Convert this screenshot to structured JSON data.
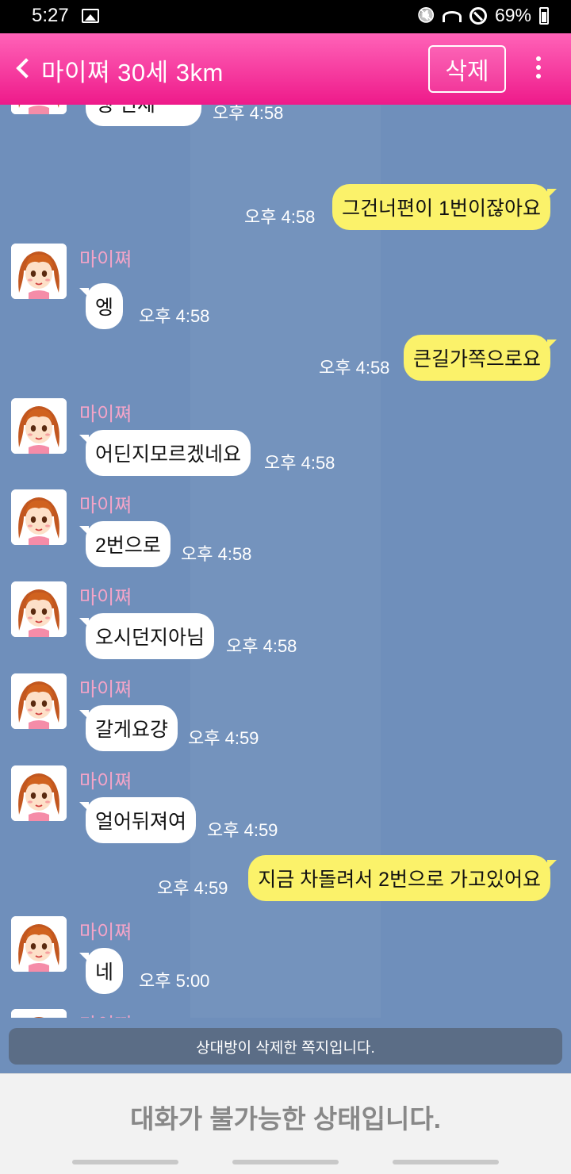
{
  "status_bar": {
    "time": "5:27",
    "battery": "69%"
  },
  "header": {
    "title": "마이쪄 30세 3km",
    "delete_label": "삭제"
  },
  "messages": [
    {
      "dir": "in",
      "sender": "마이쪄",
      "text": "엥 언제ㅡㅡ",
      "time": "오후 4:58"
    },
    {
      "dir": "out",
      "text": "그건너편이 1번이잖아요",
      "time": "오후 4:58"
    },
    {
      "dir": "in",
      "sender": "마이쪄",
      "text": "엥",
      "time": "오후 4:58"
    },
    {
      "dir": "out",
      "text": "큰길가쪽으로요",
      "time": "오후 4:58"
    },
    {
      "dir": "in",
      "sender": "마이쪄",
      "text": "어딘지모르겠네요",
      "time": "오후 4:58"
    },
    {
      "dir": "in",
      "sender": "마이쪄",
      "text": "2번으로",
      "time": "오후 4:58"
    },
    {
      "dir": "in",
      "sender": "마이쪄",
      "text": "오시던지아님",
      "time": "오후 4:58"
    },
    {
      "dir": "in",
      "sender": "마이쪄",
      "text": "갈게요걍",
      "time": "오후 4:59"
    },
    {
      "dir": "in",
      "sender": "마이쪄",
      "text": "얼어뒤져여",
      "time": "오후 4:59"
    },
    {
      "dir": "out",
      "text": "지금 차돌려서 2번으로 가고있어요",
      "time": "오후 4:59"
    },
    {
      "dir": "in",
      "sender": "마이쪄",
      "text": "네",
      "time": "오후 5:00"
    },
    {
      "dir": "in",
      "sender": "마이쪄",
      "text": "",
      "time": ""
    }
  ],
  "notice": "상대방이 삭제한 쪽지입니다.",
  "footer": "대화가 불가능한 상태입니다.",
  "colors": {
    "header": "#ee1a8a",
    "chat_bg": "#6f8fbb",
    "out_bubble": "#fbf26a",
    "sender": "#f4a4c8"
  }
}
